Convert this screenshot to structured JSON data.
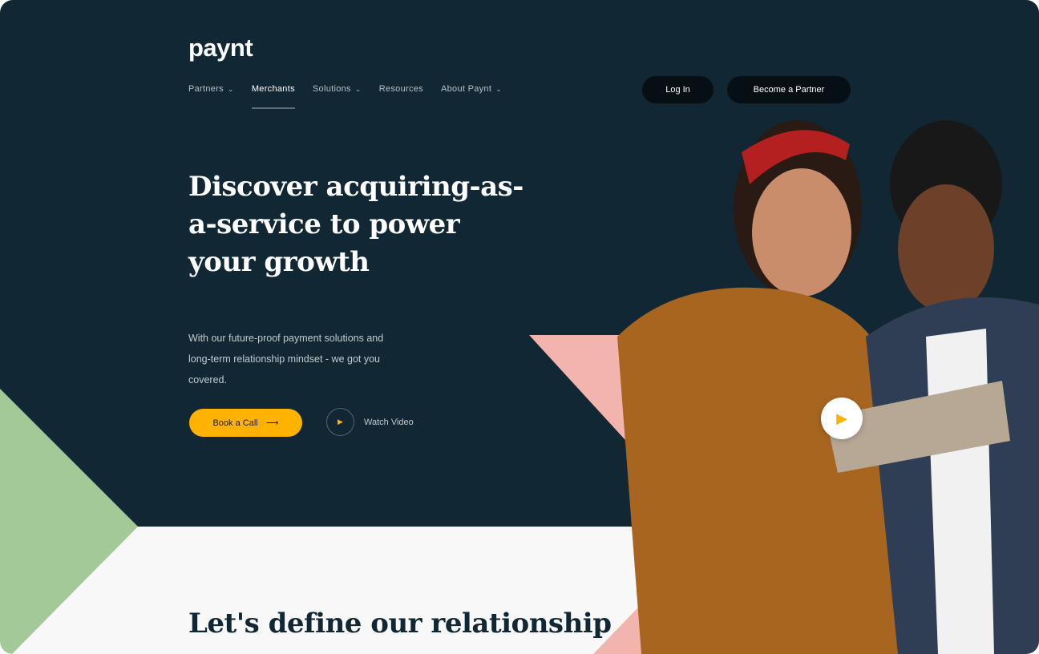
{
  "brand": {
    "logo": "paynt"
  },
  "nav": {
    "items": [
      {
        "label": "Partners",
        "dropdown": true
      },
      {
        "label": "Merchants",
        "dropdown": false,
        "active": true
      },
      {
        "label": "Solutions",
        "dropdown": true
      },
      {
        "label": "Resources",
        "dropdown": false
      },
      {
        "label": "About Paynt",
        "dropdown": true
      }
    ],
    "chevron": "⌄"
  },
  "header": {
    "login": "Log In",
    "partner": "Become a Partner"
  },
  "hero": {
    "title": "Discover acquiring-as-a-service to power your growth",
    "subtitle": "With our future-proof payment solutions and long-term relationship mindset - we got you covered.",
    "cta": "Book a Call",
    "cta_arrow": "⟶",
    "video": "Watch Video",
    "play_icon": "▶"
  },
  "section2": {
    "title": "Let's define our relationship"
  },
  "colors": {
    "dark": "#112733",
    "accent": "#ffb300",
    "green": "#a3c999",
    "pink": "#f2b5ae"
  }
}
